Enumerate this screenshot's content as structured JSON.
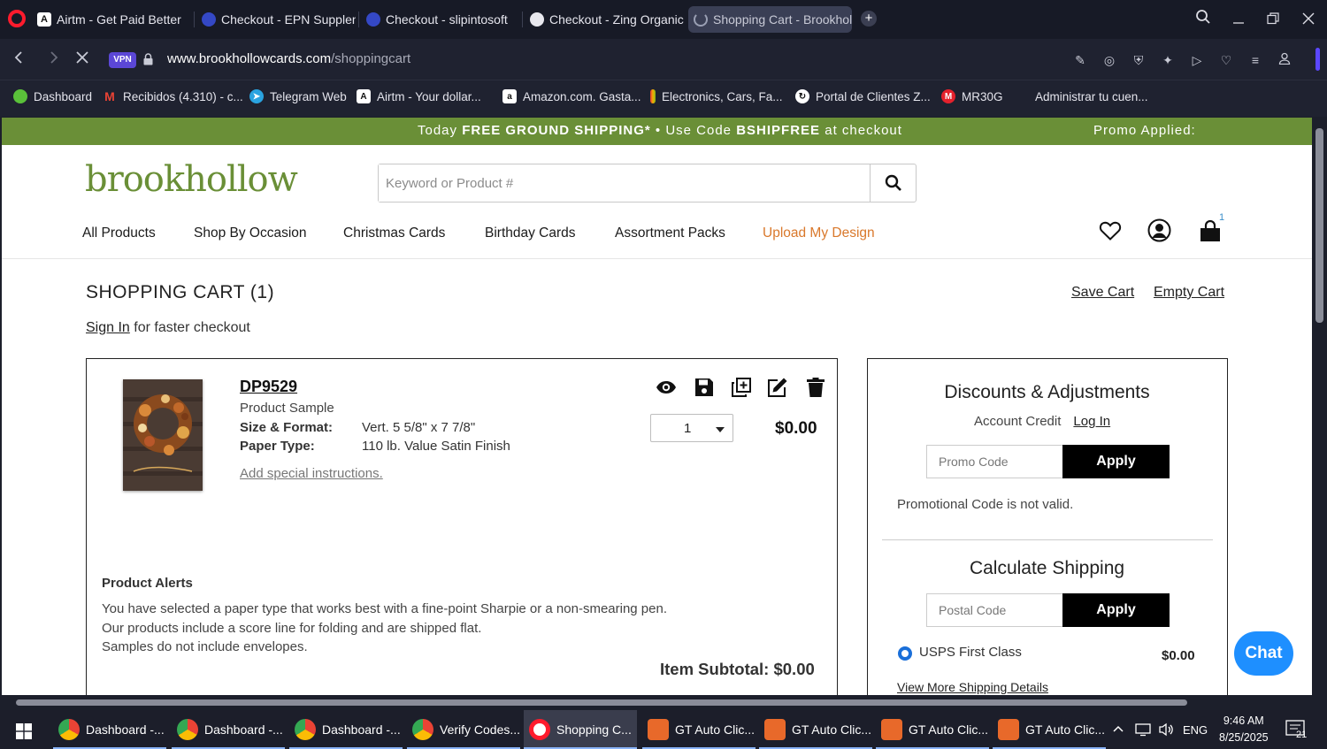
{
  "browser": {
    "tabs": [
      {
        "label": "Airtm - Get Paid Better",
        "favicon": "airtm-icon"
      },
      {
        "label": "Checkout - EPN Suppleme",
        "favicon": "epn-icon"
      },
      {
        "label": "Checkout - slipintosoft",
        "favicon": "slip-icon"
      },
      {
        "label": "Checkout - Zing Organics",
        "favicon": "globe-icon"
      },
      {
        "label": "Shopping Cart - Brookholl",
        "favicon": "loading-icon"
      }
    ],
    "address": {
      "vpn": "VPN",
      "domain": "www.brookhollowcards.com",
      "path": "/shoppingcart"
    },
    "bookmarks": [
      "Dashboard",
      "Recibidos (4.310) - c...",
      "Telegram Web",
      "Airtm - Your dollar...",
      "Amazon.com. Gasta...",
      "Electronics, Cars, Fa...",
      "Portal de Clientes Z...",
      "MR30G",
      "Administrar tu cuen..."
    ]
  },
  "site": {
    "promo_prefix": "Today ",
    "promo_bold1": "FREE GROUND SHIPPING*",
    "promo_mid": " • Use Code ",
    "promo_bold2": "BSHIPFREE",
    "promo_suffix": " at checkout",
    "promo_applied": "Promo Applied:",
    "logo": "brookhollow",
    "search_placeholder": "Keyword or Product #",
    "nav": [
      "All Products",
      "Shop By Occasion",
      "Christmas Cards",
      "Birthday Cards",
      "Assortment Packs",
      "Upload My Design"
    ],
    "cart_count": "1"
  },
  "cart": {
    "title": "SHOPPING CART (1)",
    "save_cart": "Save Cart",
    "empty_cart": "Empty Cart",
    "sign_in": "Sign In",
    "sign_in_suffix": " for faster checkout",
    "item": {
      "sku": "DP9529",
      "type": "Product Sample",
      "size_label": "Size & Format:",
      "size_value": "Vert. 5 5/8\" x 7 7/8\"",
      "paper_label": "Paper Type:",
      "paper_value": "110 lb. Value Satin Finish",
      "special": "Add special instructions.",
      "qty": "1",
      "price": "$0.00",
      "actions": [
        "eye-icon",
        "save-icon",
        "duplicate-icon",
        "edit-icon",
        "trash-icon"
      ]
    },
    "alerts_heading": "Product Alerts",
    "alerts": [
      "You have selected a paper type that works best with a fine-point Sharpie or a non-smearing pen.",
      "Our products include a score line for folding and are shipped flat.",
      "Samples do not include envelopes."
    ],
    "subtotal": "Item Subtotal: $0.00"
  },
  "discounts": {
    "heading": "Discounts & Adjustments",
    "account_credit": "Account Credit",
    "log_in": "Log In",
    "promo_placeholder": "Promo Code",
    "apply": "Apply",
    "promo_error": "Promotional Code is not valid.",
    "shipping_heading": "Calculate Shipping",
    "postal_placeholder": "Postal Code",
    "apply2": "Apply",
    "method": "USPS First Class",
    "method_price": "$0.00",
    "view_more": "View More Shipping Details"
  },
  "chat": "Chat",
  "taskbar": {
    "items": [
      "Dashboard -...",
      "Dashboard -...",
      "Dashboard -...",
      "Verify Codes...",
      "Shopping C...",
      "GT Auto Clic...",
      "GT Auto Clic...",
      "GT Auto Clic...",
      "GT Auto Clic..."
    ],
    "lang": "ENG",
    "time": "9:46 AM",
    "date": "8/25/2025",
    "notifications": "21"
  },
  "colors": {
    "brand_green": "#6a8f37",
    "upload_orange": "#d9782b",
    "chat_blue": "#1e8fff",
    "radio_blue": "#1a6fd9"
  }
}
